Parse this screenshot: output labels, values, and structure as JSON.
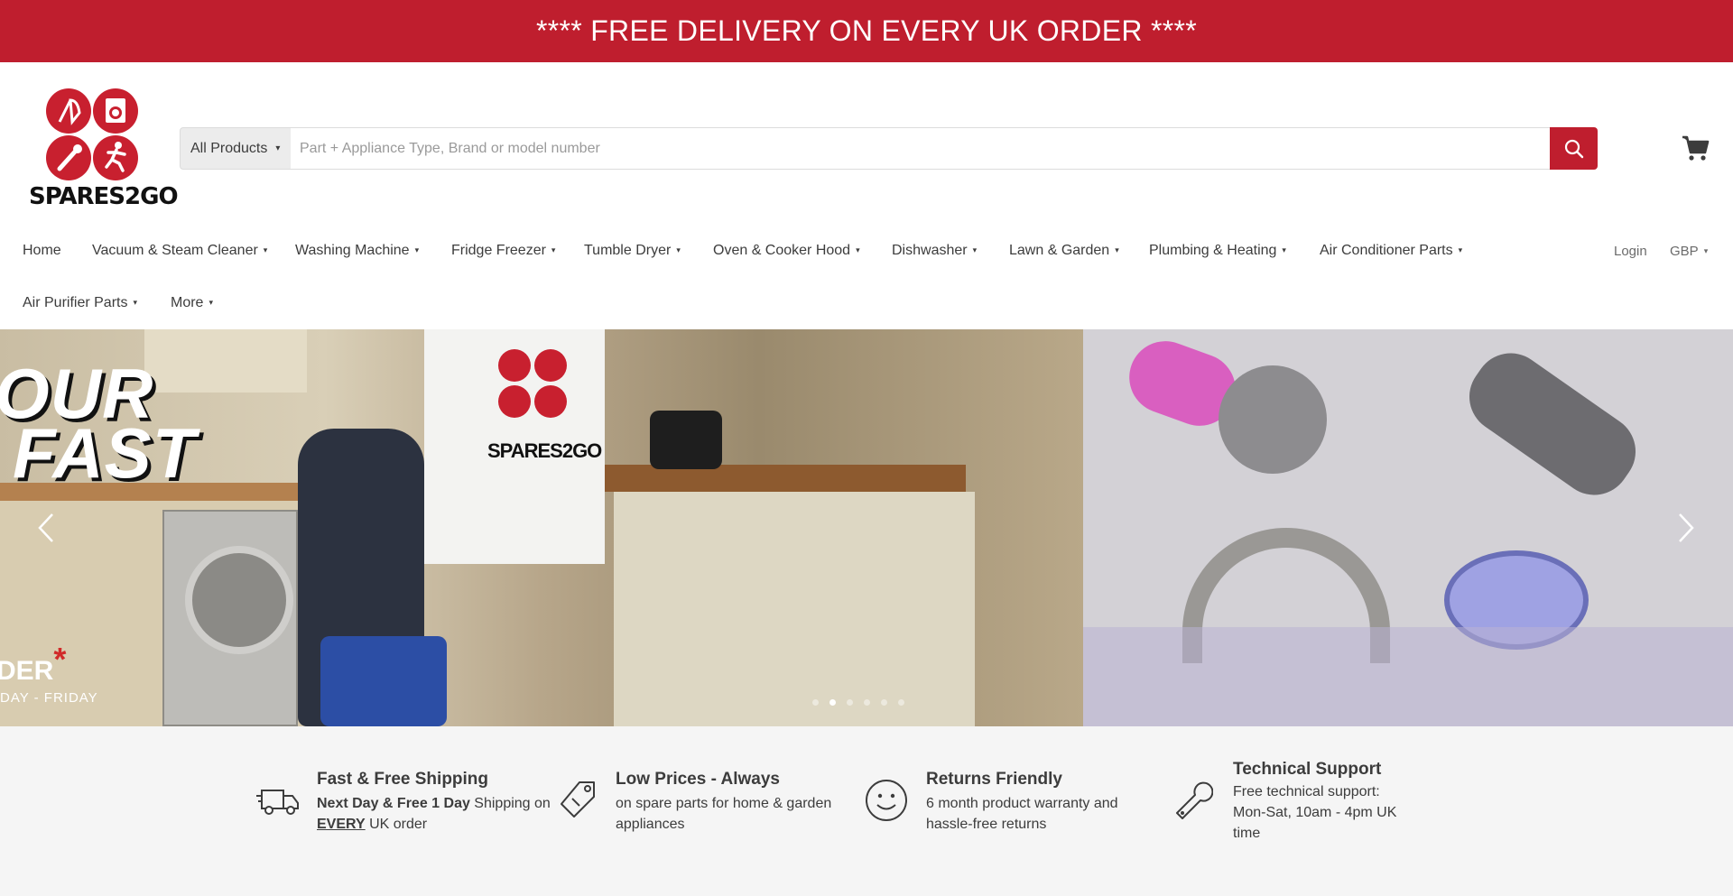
{
  "promo": {
    "text": "**** FREE DELIVERY ON EVERY UK ORDER ****",
    "bg_color": "#bf1e2e"
  },
  "logo": {
    "text": "SPARES2GO",
    "icon": "spares2go-logo"
  },
  "search": {
    "category": "All Products",
    "placeholder": "Part + Appliance Type, Brand or model number",
    "button_icon": "search-icon"
  },
  "cart": {
    "icon": "cart-icon"
  },
  "nav": {
    "items": [
      {
        "label": "Home",
        "has_dropdown": false
      },
      {
        "label": "Vacuum & Steam Cleaner",
        "has_dropdown": true
      },
      {
        "label": "Washing Machine",
        "has_dropdown": true
      },
      {
        "label": "Fridge Freezer",
        "has_dropdown": true
      },
      {
        "label": "Tumble Dryer",
        "has_dropdown": true
      },
      {
        "label": "Oven & Cooker Hood",
        "has_dropdown": true
      },
      {
        "label": "Dishwasher",
        "has_dropdown": true
      },
      {
        "label": "Lawn & Garden",
        "has_dropdown": true
      },
      {
        "label": "Plumbing & Heating",
        "has_dropdown": true
      },
      {
        "label": "Air Conditioner Parts",
        "has_dropdown": true
      },
      {
        "label": "Air Purifier Parts",
        "has_dropdown": true
      },
      {
        "label": "More",
        "has_dropdown": true
      }
    ],
    "login": "Login",
    "currency": "GBP"
  },
  "hero": {
    "line1": "OUR",
    "line2": "FAST",
    "line3": "DER",
    "line3_star": "*",
    "line4": "DAY - FRIDAY",
    "van_logo_text": "SPARES2GO",
    "slide_count": 6,
    "active_slide": 2
  },
  "features": [
    {
      "icon": "delivery-truck-icon",
      "title": "Fast & Free Shipping",
      "bold": "Next Day & Free 1 Day",
      "text": " Shipping on",
      "underline": "EVERY",
      "text2": " UK order"
    },
    {
      "icon": "price-tag-icon",
      "title": "Low Prices - Always",
      "text": "on spare parts for home & garden appliances"
    },
    {
      "icon": "smiley-icon",
      "title": "Returns Friendly",
      "text": "6 month product warranty and hassle-free returns"
    },
    {
      "icon": "wrench-icon",
      "title": "Technical Support",
      "text": "Free technical support: Mon-Sat, 10am - 4pm UK time"
    }
  ],
  "colors": {
    "accent": "#bf1e2e",
    "text": "#3c3c3c",
    "features_bg": "#f5f5f5"
  }
}
